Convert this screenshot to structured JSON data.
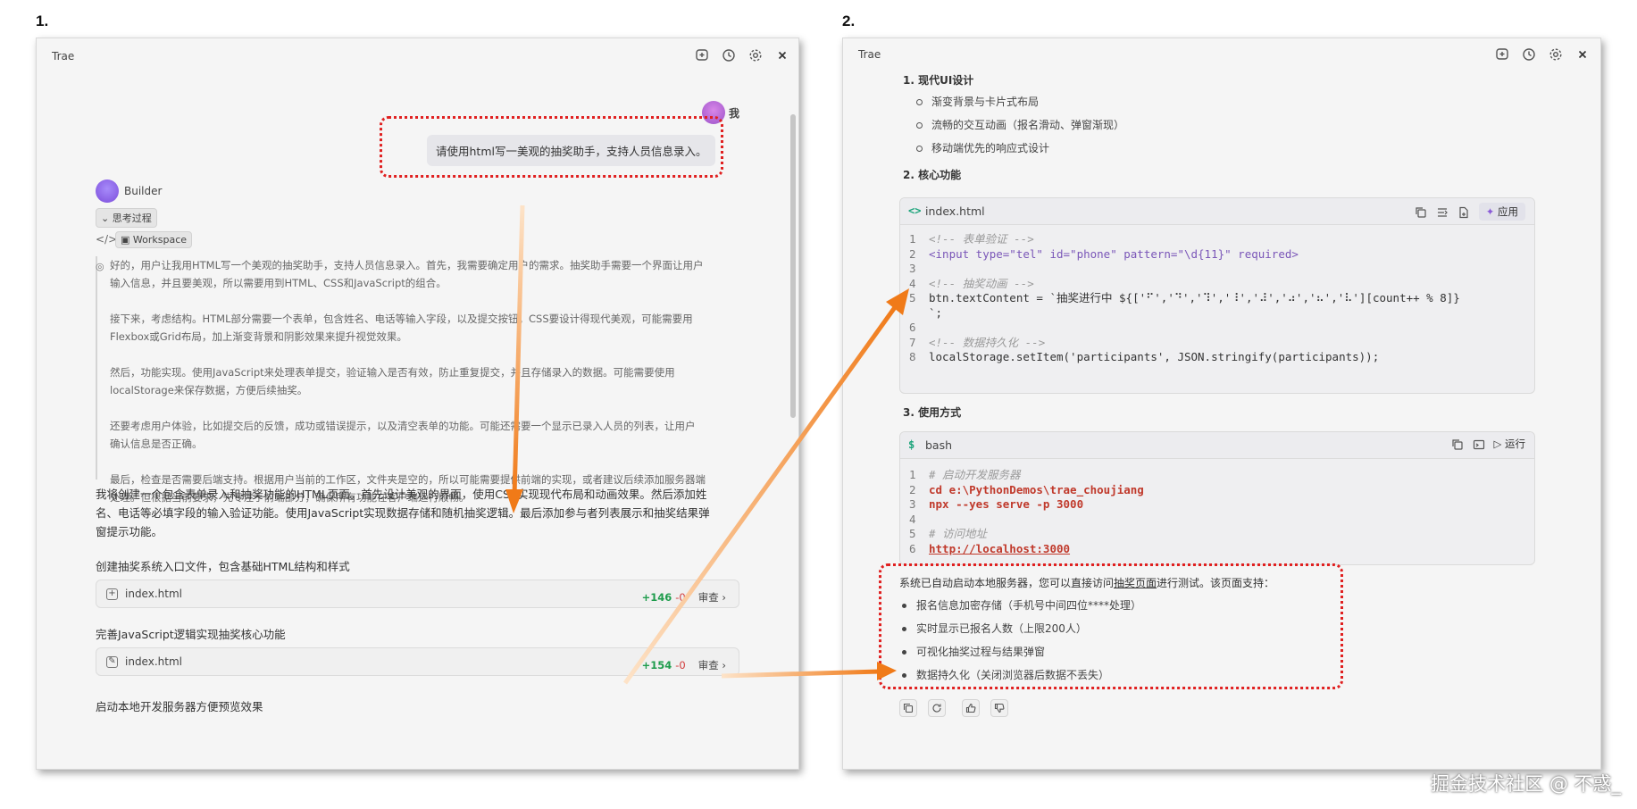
{
  "steps": [
    "1.",
    "2."
  ],
  "left_panel": {
    "title": "Trae",
    "user": {
      "name": "我",
      "message": "请使用html写一美观的抽奖助手，支持人员信息录入。"
    },
    "agent": {
      "name": "Builder",
      "thinking_toggle": "思考过程",
      "workspace": "Workspace"
    },
    "thoughts": [
      "好的，用户让我用HTML写一个美观的抽奖助手，支持人员信息录入。首先，我需要确定用户的需求。抽奖助手需要一个界面让用户",
      "输入信息，并且要美观，所以需要用到HTML、CSS和JavaScript的组合。",
      "",
      "接下来，考虑结构。HTML部分需要一个表单，包含姓名、电话等输入字段，以及提交按钮。CSS要设计得现代美观，可能需要用",
      "Flexbox或Grid布局，加上渐变背景和阴影效果来提升视觉效果。",
      "",
      "然后，功能实现。使用JavaScript来处理表单提交，验证输入是否有效，防止重复提交，并且存储录入的数据。可能需要使用",
      "localStorage来保存数据，方便后续抽奖。",
      "",
      "还要考虑用户体验，比如提交后的反馈，成功或错误提示，以及清空表单的功能。可能还需要一个显示已录入人员的列表，让用户",
      "确认信息是否正确。",
      "",
      "最后，检查是否需要后端支持。根据用户当前的工作区，文件夹是空的，所以可能需要提供前端的实现，或者建议后续添加服务器端",
      "处理。但根据当前要求，先专注于前端部分，确保所有功能在客户端运行顺畅。"
    ],
    "summary": [
      "我将创建一个包含表单录入和抽奖功能的HTML页面。首先设计美观的界面，使用CSS实现现代布局和动画效果。然后添加姓",
      "名、电话等必填字段的输入验证功能。使用JavaScript实现数据存储和随机抽奖逻辑。最后添加参与者列表展示和抽奖结果弹",
      "窗提示功能。"
    ],
    "tasks": [
      {
        "title": "创建抽奖系统入口文件，包含基础HTML结构和样式",
        "file": "index.html",
        "add": "+146",
        "del": "-0",
        "review": "审查"
      },
      {
        "title": "完善JavaScript逻辑实现抽奖核心功能",
        "file": "index.html",
        "add": "+154",
        "del": "-0",
        "review": "审查"
      }
    ],
    "last_task": "启动本地开发服务器方便预览效果"
  },
  "right_panel": {
    "title": "Trae",
    "section1": {
      "heading": "1. 现代UI设计",
      "items": [
        "渐变背景与卡片式布局",
        "流畅的交互动画（报名滑动、弹窗渐现）",
        "移动端优先的响应式设计"
      ]
    },
    "section2": {
      "heading": "2. 核心功能"
    },
    "code1": {
      "filename": "index.html",
      "apply": "应用",
      "lines": [
        {
          "n": "1",
          "t": "<!-- 表单验证 -->"
        },
        {
          "n": "2",
          "t": "<input type=\"tel\" id=\"phone\" pattern=\"\\d{11}\" required>"
        },
        {
          "n": "3",
          "t": ""
        },
        {
          "n": "4",
          "t": "<!-- 抽奖动画 -->"
        },
        {
          "n": "5",
          "t": "btn.textContent = `抽奖进行中 ${['⠋','⠙','⠹','⠸','⠼','⠴','⠦','⠧'][count++ % 8]}"
        },
        {
          "n": "",
          "t": "`;"
        },
        {
          "n": "6",
          "t": ""
        },
        {
          "n": "7",
          "t": "<!-- 数据持久化 -->"
        },
        {
          "n": "8",
          "t": "localStorage.setItem('participants', JSON.stringify(participants));"
        }
      ]
    },
    "section3": {
      "heading": "3. 使用方式"
    },
    "code2": {
      "lang": "bash",
      "run": "运行",
      "lines": [
        {
          "n": "1",
          "t": "# 启动开发服务器"
        },
        {
          "n": "2",
          "t": "cd e:\\PythonDemos\\trae_choujiang"
        },
        {
          "n": "3",
          "t": "npx --yes serve -p 3000"
        },
        {
          "n": "4",
          "t": ""
        },
        {
          "n": "5",
          "t": "# 访问地址"
        },
        {
          "n": "6",
          "t": "http://localhost:3000"
        }
      ]
    },
    "final": {
      "intro_pre": "系统已自动启动本地服务器，您可以直接访问",
      "intro_link": "抽奖页面",
      "intro_post": "进行测试。该页面支持：",
      "items": [
        "报名信息加密存储（手机号中间四位****处理）",
        "实时显示已报名人数（上限200人）",
        "可视化抽奖过程与结果弹窗",
        "数据持久化（关闭浏览器后数据不丢失）"
      ]
    }
  },
  "watermark": "掘金技术社区 @ 不惑_",
  "colors": {
    "annotation_red": "#e02020",
    "arrow_orange": "#f07a18"
  }
}
